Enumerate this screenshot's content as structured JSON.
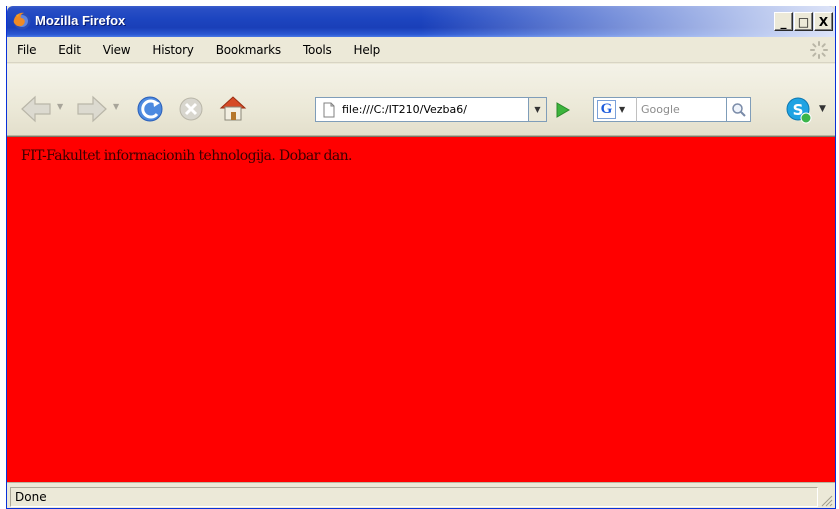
{
  "window": {
    "title": "Mozilla Firefox",
    "buttons": {
      "minimize": "_",
      "maximize": "□",
      "close": "X"
    }
  },
  "menu": {
    "items": [
      "File",
      "Edit",
      "View",
      "History",
      "Bookmarks",
      "Tools",
      "Help"
    ]
  },
  "toolbar": {
    "url": "file:///C:/IT210/Vezba6/",
    "search_placeholder": "Google",
    "search_engine_letter": "G",
    "icons": [
      "back-icon",
      "forward-icon",
      "reload-icon",
      "stop-icon",
      "home-icon",
      "page-icon",
      "go-icon",
      "search-icon",
      "skype-icon"
    ]
  },
  "content": {
    "background": "#ff0000",
    "text": "FIT-Fakultet informacionih tehnologija. Dobar dan."
  },
  "status": {
    "text": "Done"
  }
}
